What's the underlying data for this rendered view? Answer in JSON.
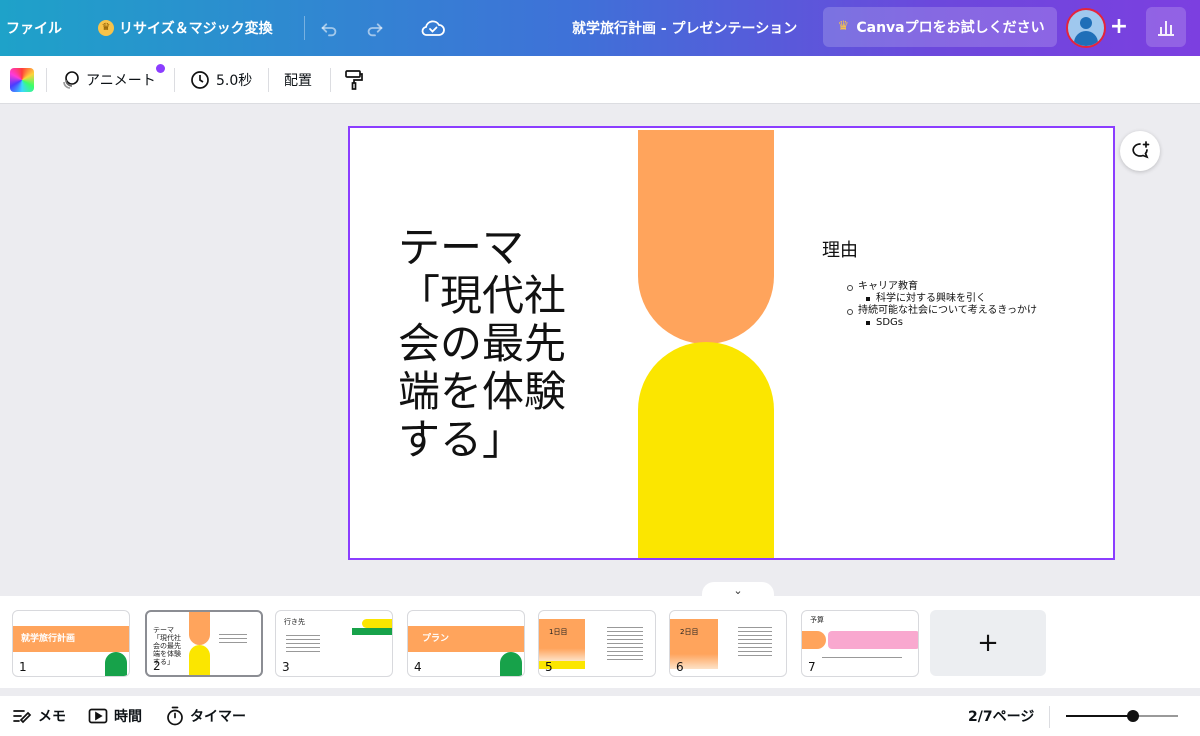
{
  "header": {
    "file_menu": "ファイル",
    "resize_label": "リサイズ＆マジック変換",
    "doc_title": "就学旅行計画 - プレゼンテーション",
    "pro_label": "Canvaプロをお試しください"
  },
  "toolbar": {
    "animate_label": "アニメート",
    "duration_label": "5.0秒",
    "position_label": "配置"
  },
  "slide": {
    "title": "テーマ「現代社会の最先端を体験する」",
    "reason_heading": "理由",
    "reason_items": [
      {
        "level": 1,
        "text": "キャリア教育"
      },
      {
        "level": 2,
        "text": "科学に対する興味を引く"
      },
      {
        "level": 1,
        "text": "持続可能な社会について考えるきっかけ"
      },
      {
        "level": 2,
        "text": "SDGs"
      }
    ],
    "shape_colors": {
      "top": "#ffa45c",
      "bottom": "#fbe600"
    }
  },
  "pages": [
    {
      "num": "1",
      "label": "就学旅行計画"
    },
    {
      "num": "2",
      "label": "テーマ「現代社会の最先端を体験する」"
    },
    {
      "num": "3",
      "label": "行き先"
    },
    {
      "num": "4",
      "label": "プラン"
    },
    {
      "num": "5",
      "label": "1日目"
    },
    {
      "num": "6",
      "label": "2日目"
    },
    {
      "num": "7",
      "label": "予算"
    }
  ],
  "footer": {
    "notes_label": "メモ",
    "duration_label": "時間",
    "timer_label": "タイマー",
    "page_indicator": "2/7ページ",
    "zoom_level_fraction": 0.6
  },
  "accent_color": "#8b3dff"
}
